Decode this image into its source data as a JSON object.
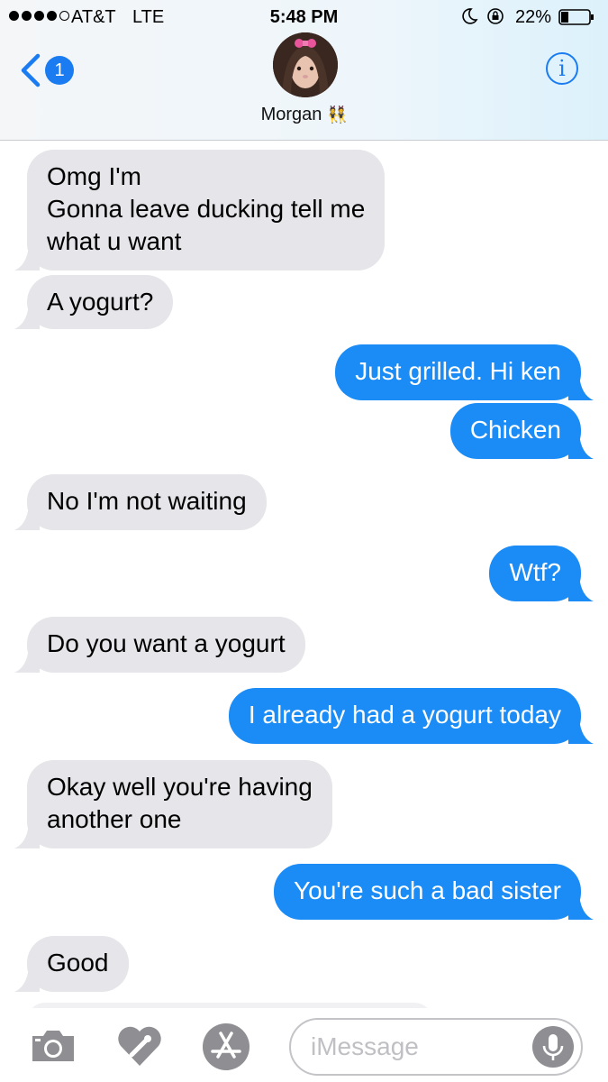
{
  "status_bar": {
    "carrier": "AT&T",
    "network": "LTE",
    "time": "5:48 PM",
    "battery": "22%",
    "battery_level": 0.22
  },
  "nav": {
    "back_badge": "1",
    "contact_name": "Morgan",
    "contact_emoji": "👯",
    "info_label": "i"
  },
  "messages": [
    {
      "from": "them",
      "lines": [
        "Omg I'm",
        "Gonna leave ducking tell me",
        "what u want"
      ]
    },
    {
      "from": "them",
      "lines": [
        "A yogurt?"
      ]
    },
    {
      "from": "me",
      "lines": [
        "Just grilled. Hi ken"
      ]
    },
    {
      "from": "me",
      "lines": [
        "Chicken"
      ]
    },
    {
      "from": "them",
      "lines": [
        "No I'm not waiting"
      ]
    },
    {
      "from": "me",
      "lines": [
        "Wtf?"
      ]
    },
    {
      "from": "them",
      "lines": [
        "Do you want a yogurt"
      ]
    },
    {
      "from": "me",
      "lines": [
        "I already had a yogurt today"
      ]
    },
    {
      "from": "them",
      "lines": [
        "Okay well you're having",
        "another one"
      ]
    },
    {
      "from": "me",
      "lines": [
        "You're such a bad sister"
      ]
    },
    {
      "from": "them",
      "lines": [
        "Good"
      ]
    }
  ],
  "input": {
    "placeholder": "iMessage"
  },
  "colors": {
    "accent": "#1a7cf0",
    "outgoing_bubble": "#1b8cf5",
    "incoming_bubble": "#e5e5ea"
  },
  "icons": [
    "camera-icon",
    "digital-touch-icon",
    "app-store-icon",
    "microphone-icon"
  ]
}
